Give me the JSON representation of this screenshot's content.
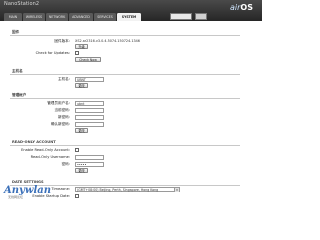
{
  "header": {
    "product_name": "NanoStation2",
    "tabs": [
      {
        "label": "MAIN",
        "active": false
      },
      {
        "label": "WIRELESS",
        "active": false
      },
      {
        "label": "NETWORK",
        "active": false
      },
      {
        "label": "ADVANCED",
        "active": false
      },
      {
        "label": "SERVICES",
        "active": false
      },
      {
        "label": "SYSTEM",
        "active": true
      }
    ],
    "logo_air": "air",
    "logo_os": "OS"
  },
  "firmware": {
    "section_title": "固件",
    "version_label": "固件版本:",
    "version_value": "XS2.ar2316.v3.0.4.5074.150724.1346",
    "upload_button": "升级",
    "check_updates_label": "Check for Updates:",
    "check_now_button": "Check Now"
  },
  "host": {
    "section_title": "主机名",
    "name_label": "主机名:",
    "name_value": "UBNT",
    "change_button": "更改"
  },
  "admin": {
    "section_title": "管理帐户",
    "username_label": "管理员用户名:",
    "username_value": "ubnt",
    "current_password_label": "当前密码:",
    "new_password_label": "新密码:",
    "verify_password_label": "确认新密码:",
    "change_button": "更改"
  },
  "readonly": {
    "section_title": "READ-ONLY ACCOUNT",
    "enable_label": "Enable Read-Only Account:",
    "username_label": "Read-Only Username:",
    "password_label": "密码:",
    "password_value": "•••••",
    "change_button": "更改"
  },
  "date": {
    "section_title": "DATE SETTINGS",
    "timezone_label": "Timezone:",
    "timezone_value": "(GMT+08:00) Beijing, Perth, Singapore, Hong Kong",
    "startup_label": "Enable Startup Date:"
  },
  "watermark": {
    "main": "Anywlan",
    "sub": "无线网论坛"
  },
  "colors": {
    "header_dark": "#2a2a2a",
    "active_tab": "#f2f2f2",
    "watermark_blue": "#3a6fb8"
  }
}
